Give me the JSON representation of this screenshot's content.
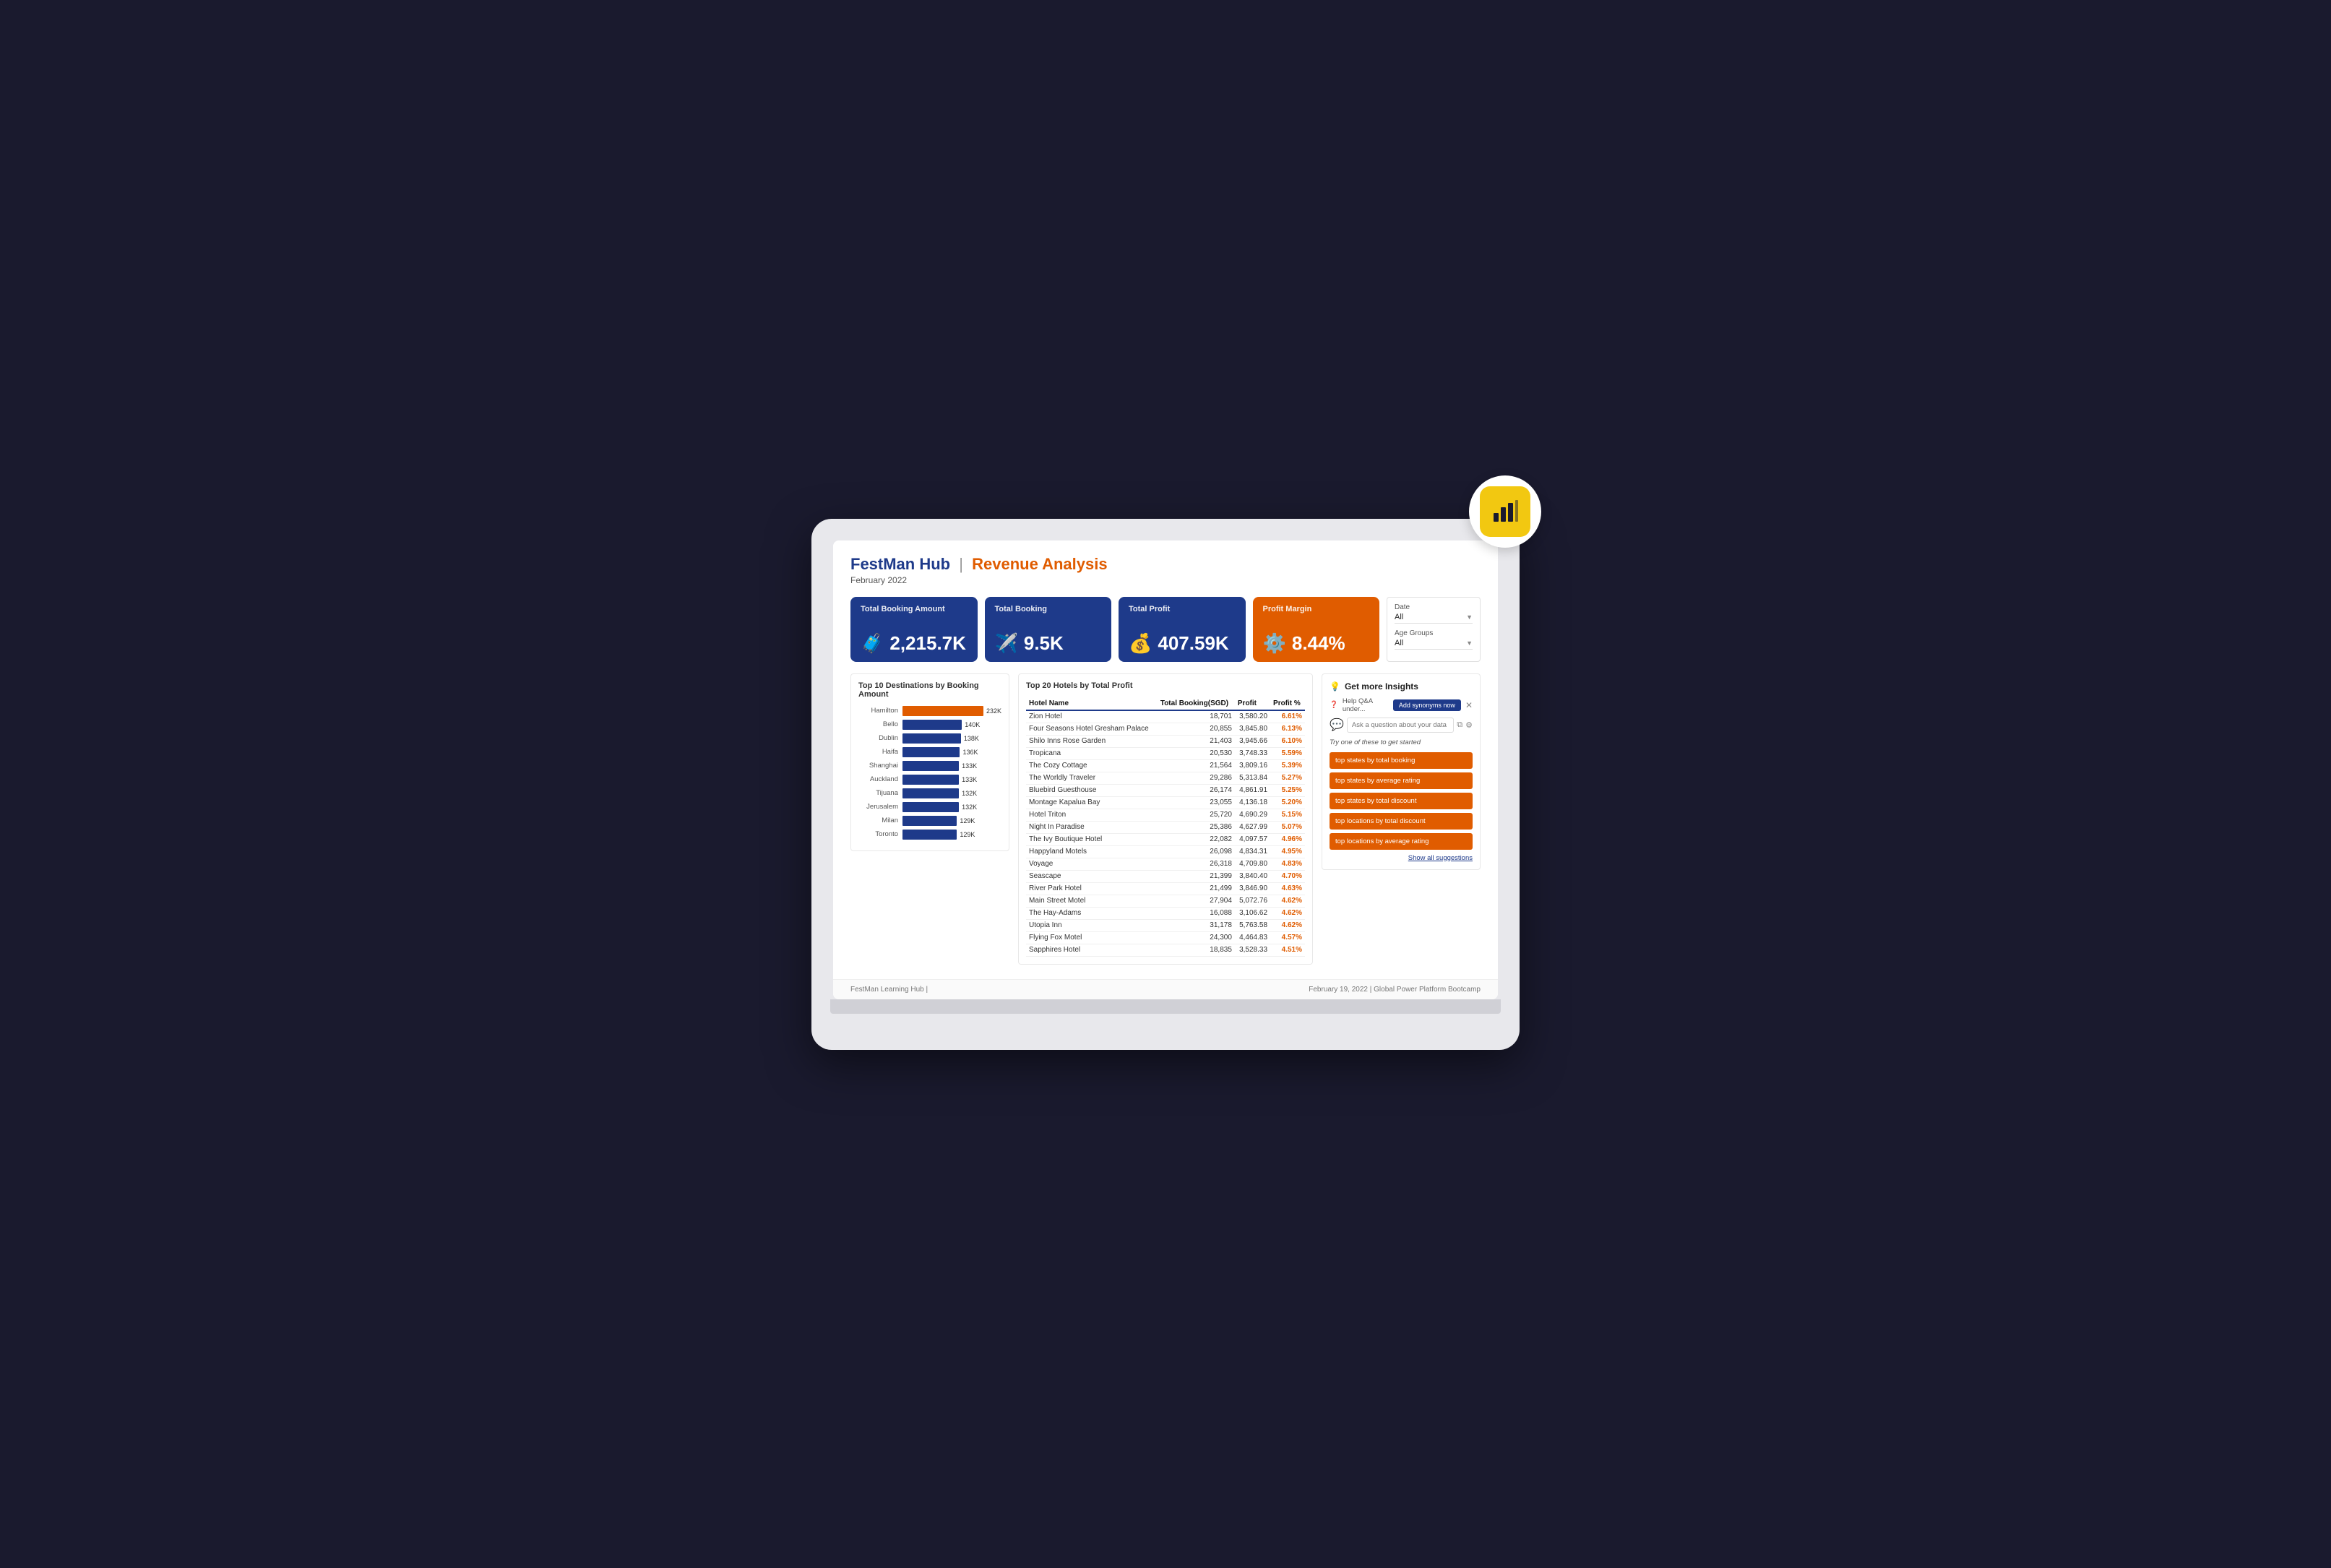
{
  "header": {
    "brand": "FestMan Hub",
    "separator": "|",
    "page_title": "Revenue Analysis",
    "subtitle": "February 2022"
  },
  "kpis": [
    {
      "label": "Total Booking Amount",
      "value": "2,215.7K",
      "icon": "🧳",
      "type": "blue"
    },
    {
      "label": "Total Booking",
      "value": "9.5K",
      "icon": "✈️",
      "type": "blue"
    },
    {
      "label": "Total Profit",
      "value": "407.59K",
      "icon": "💰",
      "type": "blue"
    },
    {
      "label": "Profit Margin",
      "value": "8.44%",
      "icon": "⚙️",
      "type": "orange"
    }
  ],
  "filters": {
    "date_label": "Date",
    "date_value": "All",
    "age_label": "Age Groups",
    "age_value": "All"
  },
  "bar_chart": {
    "title": "Top 10 Destinations by Booking Amount",
    "items": [
      {
        "label": "Hamilton",
        "value": "232K",
        "width": 100,
        "color": "#e05c00"
      },
      {
        "label": "Bello",
        "value": "140K",
        "width": 60,
        "color": "#1e3a8a"
      },
      {
        "label": "Dublin",
        "value": "138K",
        "width": 59,
        "color": "#1e3a8a"
      },
      {
        "label": "Haifa",
        "value": "136K",
        "width": 58,
        "color": "#1e3a8a"
      },
      {
        "label": "Shanghai",
        "value": "133K",
        "width": 57,
        "color": "#1e3a8a"
      },
      {
        "label": "Auckland",
        "value": "133K",
        "width": 57,
        "color": "#1e3a8a"
      },
      {
        "label": "Tijuana",
        "value": "132K",
        "width": 57,
        "color": "#1e3a8a"
      },
      {
        "label": "Jerusalem",
        "value": "132K",
        "width": 57,
        "color": "#1e3a8a"
      },
      {
        "label": "Milan",
        "value": "129K",
        "width": 55,
        "color": "#1e3a8a"
      },
      {
        "label": "Toronto",
        "value": "129K",
        "width": 55,
        "color": "#1e3a8a"
      }
    ]
  },
  "table": {
    "title": "Top 20 Hotels by Total Profit",
    "columns": [
      "Hotel Name",
      "Total Booking(SGD)",
      "Profit",
      "Profit %"
    ],
    "rows": [
      {
        "name": "Zion Hotel",
        "booking": "18,701",
        "profit": "3,580.20",
        "pct": "6.61%"
      },
      {
        "name": "Four Seasons Hotel Gresham Palace",
        "booking": "20,855",
        "profit": "3,845.80",
        "pct": "6.13%"
      },
      {
        "name": "Shilo Inns Rose Garden",
        "booking": "21,403",
        "profit": "3,945.66",
        "pct": "6.10%"
      },
      {
        "name": "Tropicana",
        "booking": "20,530",
        "profit": "3,748.33",
        "pct": "5.59%"
      },
      {
        "name": "The Cozy Cottage",
        "booking": "21,564",
        "profit": "3,809.16",
        "pct": "5.39%"
      },
      {
        "name": "The Worldly Traveler",
        "booking": "29,286",
        "profit": "5,313.84",
        "pct": "5.27%"
      },
      {
        "name": "Bluebird Guesthouse",
        "booking": "26,174",
        "profit": "4,861.91",
        "pct": "5.25%"
      },
      {
        "name": "Montage Kapalua Bay",
        "booking": "23,055",
        "profit": "4,136.18",
        "pct": "5.20%"
      },
      {
        "name": "Hotel Triton",
        "booking": "25,720",
        "profit": "4,690.29",
        "pct": "5.15%"
      },
      {
        "name": "Night In Paradise",
        "booking": "25,386",
        "profit": "4,627.99",
        "pct": "5.07%"
      },
      {
        "name": "The Ivy Boutique Hotel",
        "booking": "22,082",
        "profit": "4,097.57",
        "pct": "4.96%"
      },
      {
        "name": "Happyland Motels",
        "booking": "26,098",
        "profit": "4,834.31",
        "pct": "4.95%"
      },
      {
        "name": "Voyage",
        "booking": "26,318",
        "profit": "4,709.80",
        "pct": "4.83%"
      },
      {
        "name": "Seascape",
        "booking": "21,399",
        "profit": "3,840.40",
        "pct": "4.70%"
      },
      {
        "name": "River Park Hotel",
        "booking": "21,499",
        "profit": "3,846.90",
        "pct": "4.63%"
      },
      {
        "name": "Main Street Motel",
        "booking": "27,904",
        "profit": "5,072.76",
        "pct": "4.62%"
      },
      {
        "name": "The Hay-Adams",
        "booking": "16,088",
        "profit": "3,106.62",
        "pct": "4.62%"
      },
      {
        "name": "Utopia Inn",
        "booking": "31,178",
        "profit": "5,763.58",
        "pct": "4.62%"
      },
      {
        "name": "Flying Fox Motel",
        "booking": "24,300",
        "profit": "4,464.83",
        "pct": "4.57%"
      },
      {
        "name": "Sapphires Hotel",
        "booking": "18,835",
        "profit": "3,528.33",
        "pct": "4.51%"
      }
    ]
  },
  "insights": {
    "title": "Get more Insights",
    "qna_text": "Help Q&A under...",
    "add_synonyms": "Add synonyms now",
    "ask_placeholder": "Ask a question about your data",
    "try_text": "Try one of these to get started",
    "suggestions": [
      "top states by total booking",
      "top states by average rating",
      "top states by total discount",
      "top locations by total discount",
      "top locations by average rating"
    ],
    "show_all": "Show all suggestions"
  },
  "footer": {
    "left": "FestMan Learning Hub |",
    "right_prefix": "February 19, 2022 |",
    "right_highlight": "Global Power Platform Bootcamp"
  },
  "icons": {
    "bulb": "💡",
    "chat": "💬",
    "qna": "❓",
    "copy": "⧉",
    "settings": "⚙"
  }
}
